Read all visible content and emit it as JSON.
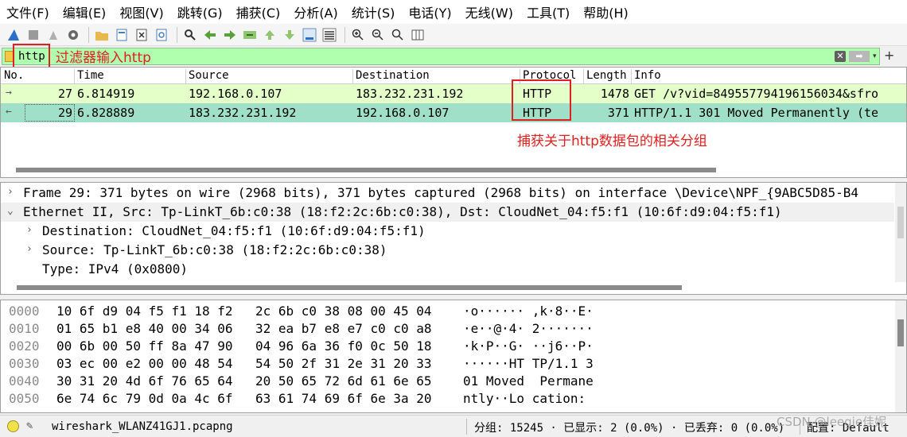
{
  "menu": [
    "文件(F)",
    "编辑(E)",
    "视图(V)",
    "跳转(G)",
    "捕获(C)",
    "分析(A)",
    "统计(S)",
    "电话(Y)",
    "无线(W)",
    "工具(T)",
    "帮助(H)"
  ],
  "toolbar_icons": [
    "shark-fin-start-icon",
    "stop-icon",
    "restart-icon",
    "options-gear-icon",
    "open-folder-icon",
    "save-file-icon",
    "close-file-icon",
    "reload-icon",
    "find-icon",
    "go-back-icon",
    "go-forward-icon",
    "go-to-packet-icon",
    "first-packet-icon",
    "last-packet-icon",
    "autoscroll-icon",
    "colorize-icon",
    "zoom-in-icon",
    "zoom-out-icon",
    "normal-size-icon",
    "resize-columns-icon"
  ],
  "filter": {
    "value": "http",
    "annotation": "过滤器输入http",
    "color": "#afffaf"
  },
  "packet_list": {
    "columns": [
      "No.",
      "Time",
      "Source",
      "Destination",
      "Protocol",
      "Length",
      "Info"
    ],
    "rows": [
      {
        "no": "27",
        "time": "6.814919",
        "source": "192.168.0.107",
        "destination": "183.232.231.192",
        "protocol": "HTTP",
        "length": "1478",
        "info": "GET /v?vid=849557794196156034&sfro"
      },
      {
        "no": "29",
        "time": "6.828889",
        "source": "183.232.231.192",
        "destination": "192.168.0.107",
        "protocol": "HTTP",
        "length": "371",
        "info": "HTTP/1.1 301 Moved Permanently  (te"
      }
    ],
    "annotation": "捕获关于http数据包的相关分组"
  },
  "details": [
    {
      "toggle": "›",
      "text": "Frame 29: 371 bytes on wire (2968 bits), 371 bytes captured (2968 bits) on interface \\Device\\NPF_{9ABC5D85-B4"
    },
    {
      "toggle": "⌄",
      "text": "Ethernet II, Src: Tp-LinkT_6b:c0:38 (18:f2:2c:6b:c0:38), Dst: CloudNet_04:f5:f1 (10:6f:d9:04:f5:f1)"
    },
    {
      "toggle": "›",
      "text": "Destination: CloudNet_04:f5:f1 (10:6f:d9:04:f5:f1)"
    },
    {
      "toggle": "›",
      "text": "Source: Tp-LinkT_6b:c0:38 (18:f2:2c:6b:c0:38)"
    },
    {
      "toggle": "",
      "text": "Type: IPv4 (0x0800)"
    }
  ],
  "hex": [
    {
      "offset": "0000",
      "h1": "10 6f d9 04 f5 f1 18 f2",
      "h2": "2c 6b c0 38 08 00 45 04",
      "ascii": "·o······ ,k·8··E·"
    },
    {
      "offset": "0010",
      "h1": "01 65 b1 e8 40 00 34 06",
      "h2": "32 ea b7 e8 e7 c0 c0 a8",
      "ascii": "·e··@·4· 2·······"
    },
    {
      "offset": "0020",
      "h1": "00 6b 00 50 ff 8a 47 90",
      "h2": "04 96 6a 36 f0 0c 50 18",
      "ascii": "·k·P··G· ··j6··P·"
    },
    {
      "offset": "0030",
      "h1": "03 ec 00 e2 00 00 48 54",
      "h2": "54 50 2f 31 2e 31 20 33",
      "ascii": "······HT TP/1.1 3"
    },
    {
      "offset": "0040",
      "h1": "30 31 20 4d 6f 76 65 64",
      "h2": "20 50 65 72 6d 61 6e 65",
      "ascii": "01 Moved  Permane"
    },
    {
      "offset": "0050",
      "h1": "6e 74 6c 79 0d 0a 4c 6f",
      "h2": "63 61 74 69 6f 6e 3a 20",
      "ascii": "ntly··Lo cation: "
    }
  ],
  "status": {
    "file": "wireshark_WLANZ41GJ1.pcapng",
    "stats": "分组: 15245 · 已显示: 2 (0.0%) · 已丢弃: 0 (0.0%)",
    "profile": "配置: Default"
  },
  "watermark": "CSDN @leegie佳妮",
  "colors": {
    "row_even": "#e4ffc7",
    "row_selected": "#a0dfc8",
    "annotation": "#e02020"
  }
}
